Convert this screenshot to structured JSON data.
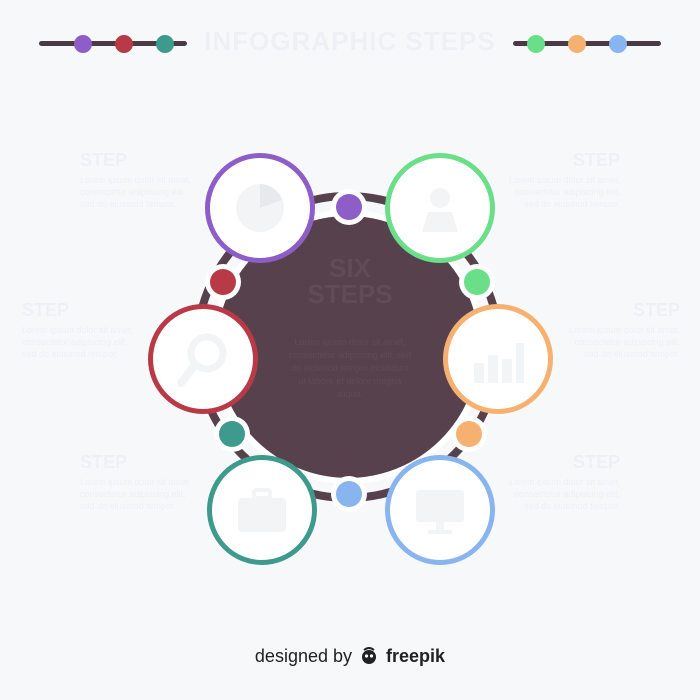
{
  "title": "INFOGRAPHIC STEPS",
  "center": {
    "title_line1": "SIX",
    "title_line2": "STEPS",
    "text": "Lorem ipsum dolor sit amet, consectetur adipiscing elit, sed do eiusmod tempor incididunt ut labore et dolore magna aliqua."
  },
  "steps": [
    {
      "label": "STEP",
      "text": "Lorem ipsum dolor sit amet, consectetur adipiscing elit, sed do eiusmod tempor.",
      "color": "#8e5ec8",
      "icon": "pie-chart-icon"
    },
    {
      "label": "STEP",
      "text": "Lorem ipsum dolor sit amet, consectetur adipiscing elit, sed do eiusmod tempor.",
      "color": "#6bde8a",
      "icon": "user-icon"
    },
    {
      "label": "STEP",
      "text": "Lorem ipsum dolor sit amet, consectetur adipiscing elit, sed do eiusmod tempor.",
      "color": "#b93a47",
      "icon": "magnifier-icon"
    },
    {
      "label": "STEP",
      "text": "Lorem ipsum dolor sit amet, consectetur adipiscing elit, sed do eiusmod tempor.",
      "color": "#f6b170",
      "icon": "bar-chart-icon"
    },
    {
      "label": "STEP",
      "text": "Lorem ipsum dolor sit amet, consectetur adipiscing elit, sed do eiusmod tempor.",
      "color": "#3e9a8c",
      "icon": "briefcase-icon"
    },
    {
      "label": "STEP",
      "text": "Lorem ipsum dolor sit amet, consectetur adipiscing elit, sed do eiusmod tempor.",
      "color": "#88b4f0",
      "icon": "monitor-icon"
    }
  ],
  "colors": {
    "center_fill": "#57414c",
    "background": "#f7f8fa",
    "text_dark": "#222222"
  },
  "footer": {
    "prefix": "designed by",
    "brand": "freepik",
    "logo_icon": "freepik-logo-icon"
  }
}
